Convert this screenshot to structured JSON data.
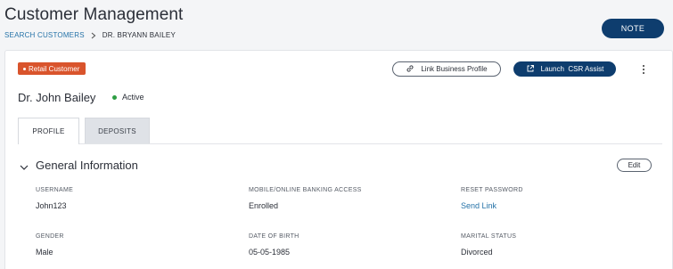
{
  "header": {
    "title": "Customer Management",
    "breadcrumb": {
      "link": "SEARCH CUSTOMERS",
      "current": "DR. BRYANN BAILEY"
    },
    "note_label": "NOTE"
  },
  "card": {
    "badge": "Retail Customer",
    "actions": {
      "link_business_profile": "Link Business Profile",
      "launch_csr_assist": "Launch  CSR Assist"
    },
    "customer_name": "Dr. John Bailey",
    "status": "Active",
    "tabs": [
      {
        "label": "PROFILE",
        "active": true
      },
      {
        "label": "DEPOSITS",
        "active": false
      }
    ]
  },
  "general_information": {
    "title": "General Information",
    "edit_label": "Edit",
    "fields": [
      {
        "label": "USERNAME",
        "value": "John123"
      },
      {
        "label": "MOBILE/ONLINE BANKING ACCESS",
        "value": "Enrolled"
      },
      {
        "label": "RESET PASSWORD",
        "value": "Send Link"
      },
      {
        "label": "GENDER",
        "value": "Male"
      },
      {
        "label": "DATE OF BIRTH",
        "value": "05-05-1985"
      },
      {
        "label": "MARITAL STATUS",
        "value": "Divorced"
      }
    ]
  },
  "colors": {
    "primary_navy": "#0e3d6e",
    "badge_orange": "#d9542c",
    "status_green": "#2f9e44",
    "link_blue": "#2673a8"
  },
  "icons": {
    "breadcrumb_separator": "chevron-right-icon",
    "link": "link-icon",
    "launch": "external-link-icon",
    "menu": "kebab-menu-icon",
    "section": "chevron-down-icon"
  }
}
